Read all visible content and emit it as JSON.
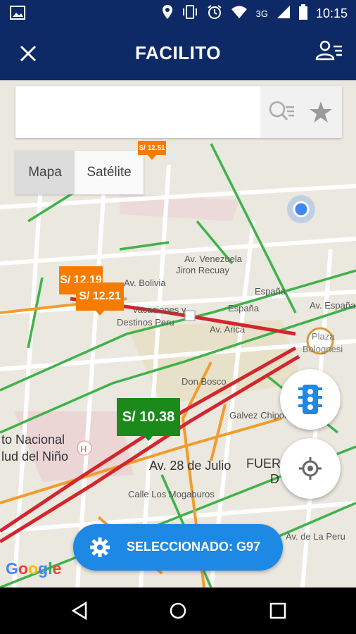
{
  "status_bar": {
    "time": "10:15",
    "network": "3G",
    "icons": [
      "image-icon",
      "location-icon",
      "vibrate-icon",
      "alarm-icon",
      "wifi-icon",
      "signal-icon",
      "battery-icon"
    ]
  },
  "app_bar": {
    "title": "FACILITO",
    "close_icon": "close-icon",
    "profile_icon": "user-list-icon"
  },
  "search": {
    "value": "",
    "placeholder": "",
    "search_icon": "search-list-icon",
    "favorite_icon": "star-icon"
  },
  "map_type": {
    "options": [
      "Mapa",
      "Satélite"
    ],
    "selected": "Mapa"
  },
  "price_markers": [
    {
      "label": "S/ 12.51",
      "color": "#f57c00"
    },
    {
      "label": "S/ 12.19",
      "color": "#f57c00"
    },
    {
      "label": "S/ 12.21",
      "color": "#f57c00"
    },
    {
      "label": "S/ 10.38",
      "color": "#1b8a1b"
    }
  ],
  "map_labels": {
    "av_venezuela": "Av. Venezuela",
    "jiron_recuay": "Jiron Recuay",
    "av_bolivia": "Av. Bolivia",
    "espana_1": "España",
    "espana_2": "España",
    "av_espana": "Av. España",
    "vacaciones": "Vacaciones y",
    "destinos": "Destinos Peru",
    "av_arica": "Av. Arica",
    "plaza_1": "Plaza",
    "plaza_2": "Bolognesi",
    "don_bosco": "Don Bosco",
    "galvez": "Galvez Chipoco",
    "instituto_1": "to Nacional",
    "instituto_2": "lud del Niño",
    "av_28": "Av. 28 de Julio",
    "fuerza_1": "FUER",
    "fuerza_2": "D",
    "mogaburos": "Calle Los Mogaburos",
    "la_peru": "Av. de La Peru"
  },
  "selected_button": {
    "label": "SELECCIONADO: G97",
    "icon": "gear-icon"
  },
  "google_logo": "Google",
  "fabs": {
    "traffic_icon": "traffic-light-icon",
    "location_icon": "my-location-icon"
  },
  "colors": {
    "primary": "#0d2a66",
    "accent": "#1e88e5",
    "price_orange": "#f57c00",
    "price_green": "#1b8a1b"
  },
  "nav_bar": {
    "icons": [
      "back-icon",
      "home-icon",
      "recents-icon"
    ]
  }
}
